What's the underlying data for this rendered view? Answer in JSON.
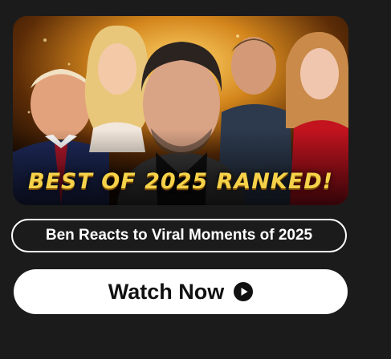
{
  "thumbnail": {
    "headline": "BEST OF 2025 RANKED!",
    "image_description_icon": "video-thumbnail-image"
  },
  "video_title": "Ben Reacts to Viral Moments of 2025",
  "watch_button": {
    "label": "Watch Now",
    "icon": "play-circle-icon"
  },
  "colors": {
    "background": "#1b1b1b",
    "headline": "#f5d24a",
    "button_bg": "#ffffff",
    "button_text": "#111111"
  }
}
